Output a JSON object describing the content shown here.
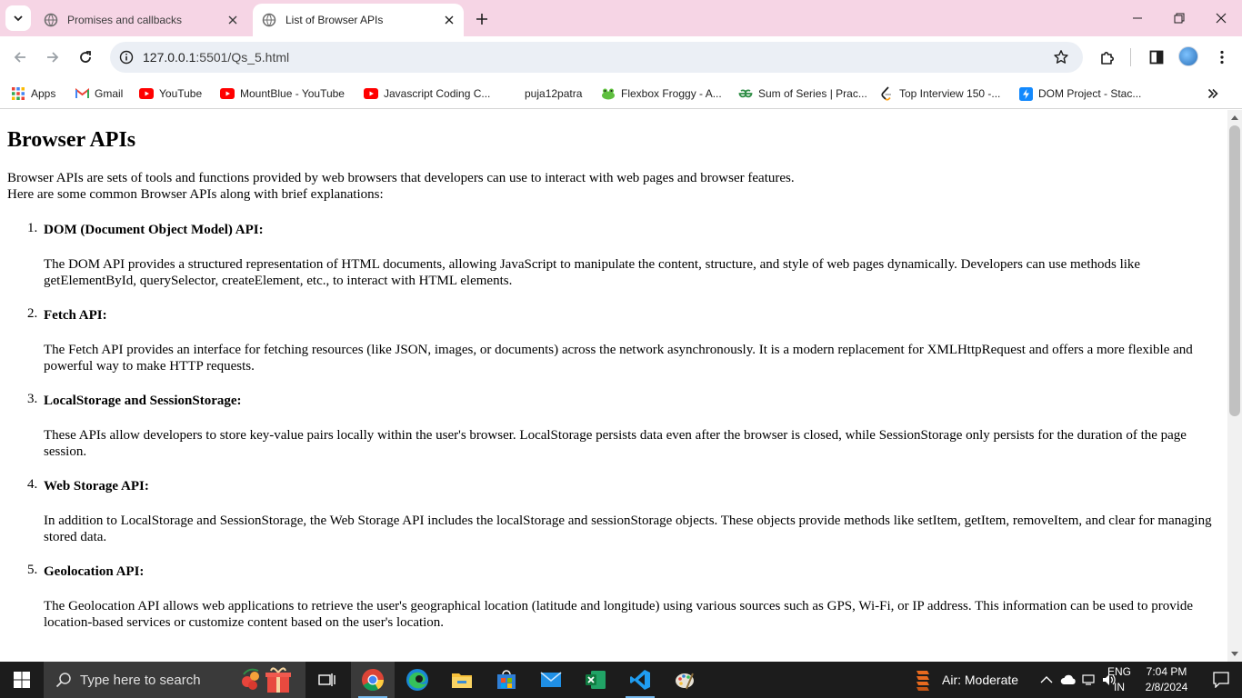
{
  "browser": {
    "tabs": [
      {
        "title": "Promises and callbacks",
        "active": false
      },
      {
        "title": "List of Browser APIs",
        "active": true
      }
    ],
    "address": {
      "host": "127.0.0.1",
      "path": ":5501/Qs_5.html"
    },
    "bookmarks": [
      {
        "label": "Apps",
        "icon": "apps-grid-icon"
      },
      {
        "label": "Gmail",
        "icon": "gmail-icon"
      },
      {
        "label": "YouTube",
        "icon": "youtube-icon"
      },
      {
        "label": "MountBlue - YouTube",
        "icon": "youtube-icon"
      },
      {
        "label": "Javascript Coding C...",
        "icon": "youtube-icon"
      },
      {
        "label": "puja12patra",
        "icon": "blank-icon"
      },
      {
        "label": "Flexbox Froggy - A...",
        "icon": "frog-icon"
      },
      {
        "label": "Sum of Series | Prac...",
        "icon": "gfg-icon"
      },
      {
        "label": "Top Interview 150 -...",
        "icon": "leetcode-icon"
      },
      {
        "label": "DOM Project - Stac...",
        "icon": "stackblitz-icon"
      }
    ]
  },
  "page": {
    "title": "Browser APIs",
    "intro_line1": "Browser APIs are sets of tools and functions provided by web browsers that developers can use to interact with web pages and browser features.",
    "intro_line2": "Here are some common Browser APIs along with brief explanations:",
    "items": [
      {
        "num": "1.",
        "heading": "DOM (Document Object Model) API:",
        "desc": "The DOM API provides a structured representation of HTML documents, allowing JavaScript to manipulate the content, structure, and style of web pages dynamically. Developers can use methods like getElementById, querySelector, createElement, etc., to interact with HTML elements."
      },
      {
        "num": "2.",
        "heading": "Fetch API:",
        "desc": "The Fetch API provides an interface for fetching resources (like JSON, images, or documents) across the network asynchronously. It is a modern replacement for XMLHttpRequest and offers a more flexible and powerful way to make HTTP requests."
      },
      {
        "num": "3.",
        "heading": "LocalStorage and SessionStorage:",
        "desc": "These APIs allow developers to store key-value pairs locally within the user's browser. LocalStorage persists data even after the browser is closed, while SessionStorage only persists for the duration of the page session."
      },
      {
        "num": "4.",
        "heading": "Web Storage API:",
        "desc": "In addition to LocalStorage and SessionStorage, the Web Storage API includes the localStorage and sessionStorage objects. These objects provide methods like setItem, getItem, removeItem, and clear for managing stored data."
      },
      {
        "num": "5.",
        "heading": "Geolocation API:",
        "desc": "The Geolocation API allows web applications to retrieve the user's geographical location (latitude and longitude) using various sources such as GPS, Wi-Fi, or IP address. This information can be used to provide location-based services or customize content based on the user's location."
      }
    ]
  },
  "taskbar": {
    "search_placeholder": "Type here to search",
    "weather": "Air: Moderate",
    "lang_line1": "ENG",
    "lang_line2": "IN",
    "time": "7:04 PM",
    "date": "2/8/2024"
  },
  "colors": {
    "tabstrip_bg": "#f6d5e5",
    "omnibox_bg": "#ebeff5",
    "taskbar_bg": "#1c1c1c"
  }
}
